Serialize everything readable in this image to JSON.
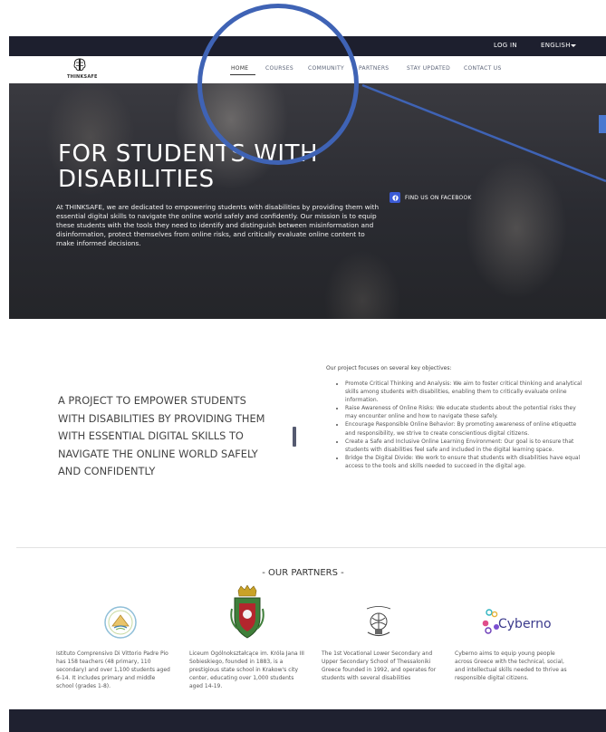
{
  "topbar": {
    "login": "LOG IN",
    "language": "ENGLISH"
  },
  "header": {
    "logo_text": "THINKSAFE",
    "nav": [
      {
        "label": "HOME"
      },
      {
        "label": "COURSES"
      },
      {
        "label": "COMMUNITY"
      },
      {
        "label": "PARTNERS"
      },
      {
        "label": "STAY UPDATED"
      },
      {
        "label": "CONTACT US"
      }
    ]
  },
  "hero": {
    "title": "FOR STUDENTS WITH DISABILITIES",
    "text": "At THINKSAFE, we are dedicated to empowering students with disabilities by providing them with essential digital skills to navigate the online world safely and confidently. Our mission is to equip these students with the tools they need to identify and distinguish between misinformation and disinformation, protect themselves from online risks, and critically evaluate online content to make informed decisions.",
    "facebook": "FIND US ON FACEBOOK"
  },
  "project": {
    "title": "A PROJECT TO EMPOWER STUDENTS WITH DISABILITIES BY PROVIDING THEM WITH ESSENTIAL DIGITAL SKILLS TO NAVIGATE THE ONLINE WORLD SAFELY AND CONFIDENTLY",
    "intro": "Our project focuses on several key objectives:",
    "objectives": [
      "Promote Critical Thinking and Analysis: We aim to foster critical thinking and analytical skills among students with disabilities, enabling them to critically evaluate online information.",
      "Raise Awareness of Online Risks: We educate students about the potential risks they may encounter online and how to navigate these safely.",
      "Encourage Responsible Online Behavior: By promoting awareness of online etiquette and responsibility, we strive to create conscientious digital citizens.",
      "Create a Safe and Inclusive Online Learning Environment: Our goal is to ensure that students with disabilities feel safe and included in the digital learning space.",
      "Bridge the Digital Divide: We work to ensure that students with disabilities have equal access to the tools and skills needed to succeed in the digital age."
    ]
  },
  "partners": {
    "title": "- OUR PARTNERS -",
    "items": [
      {
        "desc": "Istituto Comprensivo Di Vittorio Padre Pio has 158 teachers (48 primary, 110 secondary) and over 1,100 students aged 6-14. It includes primary and middle school (grades 1-8)."
      },
      {
        "desc": "Liceum Ogólnokształcące im. Króla Jana III Sobieskiego, founded in 1883, is a prestigious state school in Krakow's city center, educating over 1,000 students aged 14-19."
      },
      {
        "desc": "The 1st Vocational Lower Secondary and Upper Secondary School of Thessaloniki Greece founded in 1992, and operates for students with several disabilities"
      },
      {
        "name": "Cyberno",
        "desc": "Cyberno aims to equip young people across Greece with the technical, social, and intellectual skills needed to thrive as responsible digital citizens."
      }
    ]
  },
  "colors": {
    "topbar": "#1d1f2e",
    "accent": "#3f63b5",
    "facebook": "#3b5bd6"
  }
}
